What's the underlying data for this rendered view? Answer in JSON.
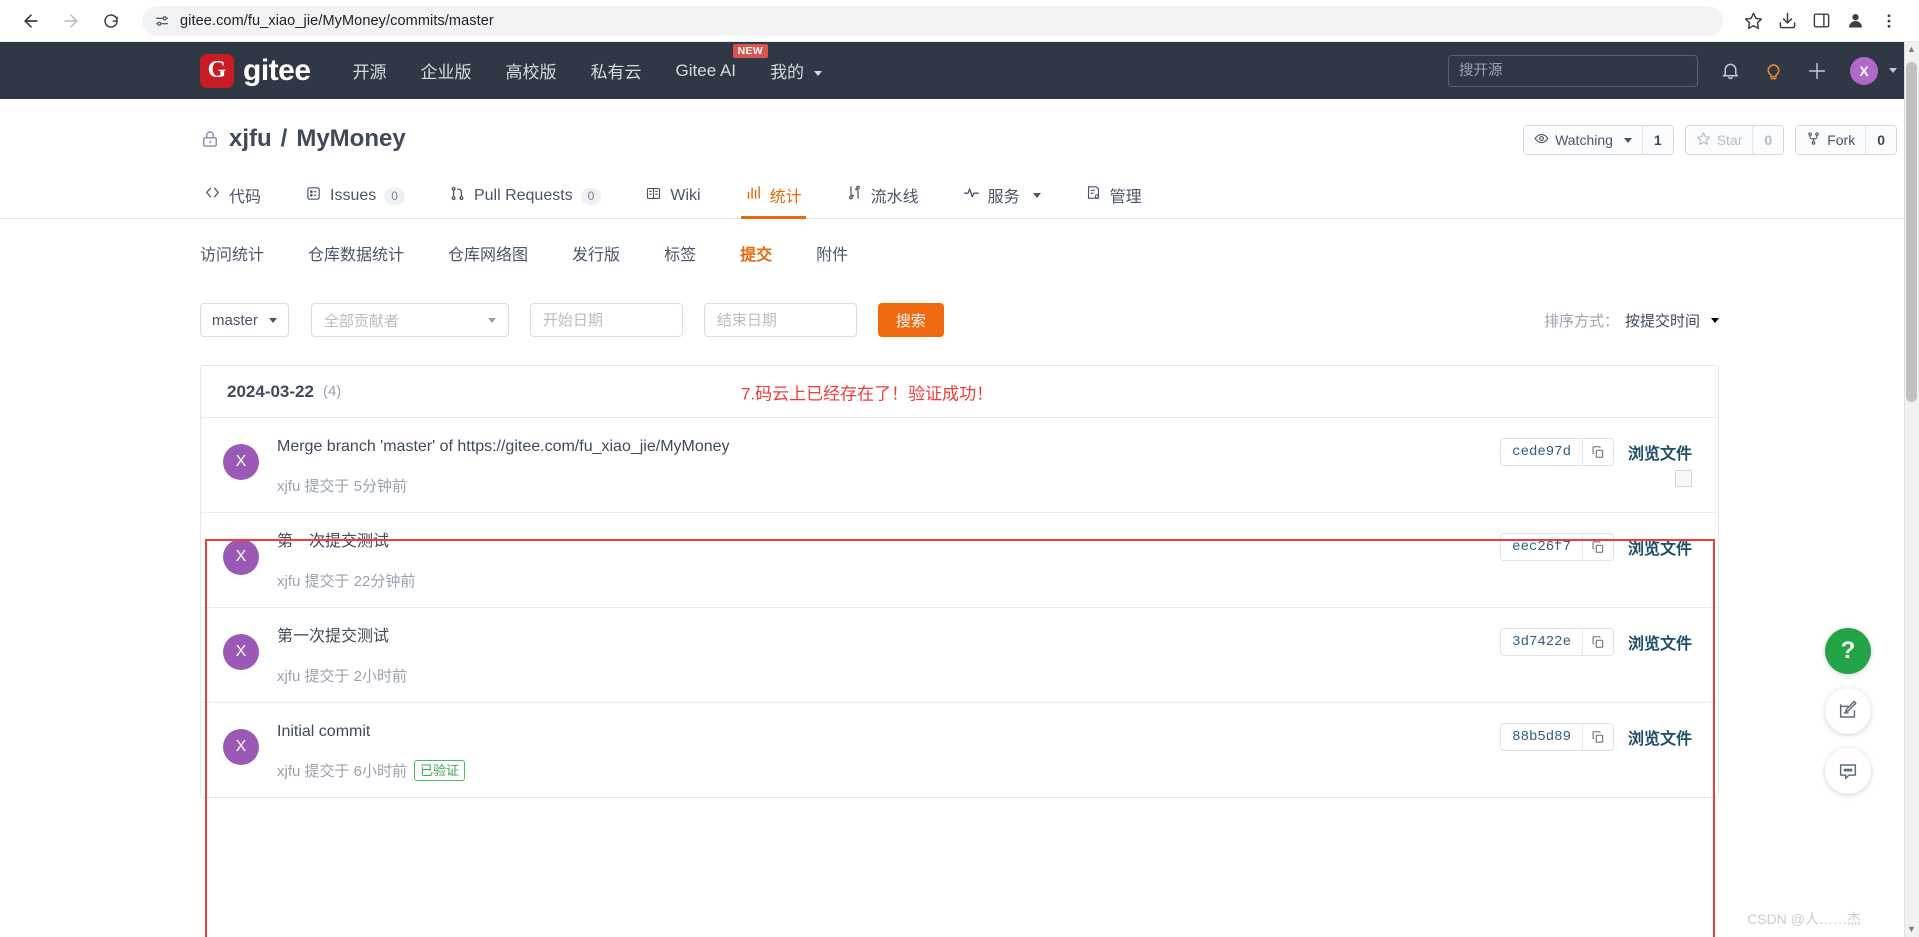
{
  "browser": {
    "url": "gitee.com/fu_xiao_jie/MyMoney/commits/master",
    "back_icon": "back-arrow-icon",
    "forward_icon": "forward-arrow-icon",
    "reload_icon": "reload-icon",
    "site_info_icon": "site-settings-icon",
    "bookmark_icon": "star-icon",
    "download_icon": "download-icon",
    "sidepanel_icon": "side-panel-icon",
    "profile_icon": "profile-icon",
    "menu_icon": "kebab-menu-icon"
  },
  "header": {
    "logo_mark": "G",
    "logo_text": "gitee",
    "nav": [
      {
        "label": "开源",
        "badge": null
      },
      {
        "label": "企业版",
        "badge": null
      },
      {
        "label": "高校版",
        "badge": null
      },
      {
        "label": "私有云",
        "badge": null
      },
      {
        "label": "Gitee AI",
        "badge": "NEW"
      },
      {
        "label": "我的",
        "badge": null
      }
    ],
    "search_placeholder": "搜开源",
    "icons": {
      "bell": "bell-icon",
      "bulb": "lightbulb-icon",
      "plus": "plus-icon"
    },
    "avatar_letter": "X",
    "accent_color": "#c71d23",
    "bg_color": "#2f3844"
  },
  "repo": {
    "owner": "xjfu",
    "separator": "/",
    "name": "MyMoney",
    "visibility_icon": "lock-icon",
    "actions": [
      {
        "id": "watching",
        "icon": "eye-icon",
        "label": "Watching",
        "count": "1",
        "muted": false,
        "has_caret": true
      },
      {
        "id": "star",
        "icon": "star-icon",
        "label": "Star",
        "count": "0",
        "muted": true,
        "has_caret": false
      },
      {
        "id": "fork",
        "icon": "fork-icon",
        "label": "Fork",
        "count": "0",
        "muted": false,
        "has_caret": false
      }
    ],
    "tabs": [
      {
        "id": "code",
        "icon": "code-icon",
        "label": "代码",
        "count": null,
        "active": false,
        "caret": false
      },
      {
        "id": "issues",
        "icon": "issue-icon",
        "label": "Issues",
        "count": "0",
        "active": false,
        "caret": false
      },
      {
        "id": "pulls",
        "icon": "pull-request-icon",
        "label": "Pull Requests",
        "count": "0",
        "active": false,
        "caret": false
      },
      {
        "id": "wiki",
        "icon": "wiki-icon",
        "label": "Wiki",
        "count": null,
        "active": false,
        "caret": false
      },
      {
        "id": "stats",
        "icon": "chart-icon",
        "label": "统计",
        "count": null,
        "active": true,
        "caret": false
      },
      {
        "id": "pipeline",
        "icon": "pipeline-icon",
        "label": "流水线",
        "count": null,
        "active": false,
        "caret": false
      },
      {
        "id": "service",
        "icon": "pulse-icon",
        "label": "服务",
        "count": null,
        "active": false,
        "caret": true
      },
      {
        "id": "manage",
        "icon": "settings-doc-icon",
        "label": "管理",
        "count": null,
        "active": false,
        "caret": false
      }
    ]
  },
  "subnav": [
    {
      "id": "visits",
      "label": "访问统计",
      "active": false
    },
    {
      "id": "repo-data",
      "label": "仓库数据统计",
      "active": false
    },
    {
      "id": "network",
      "label": "仓库网络图",
      "active": false
    },
    {
      "id": "releases",
      "label": "发行版",
      "active": false
    },
    {
      "id": "tags",
      "label": "标签",
      "active": false
    },
    {
      "id": "commits",
      "label": "提交",
      "active": true
    },
    {
      "id": "attachments",
      "label": "附件",
      "active": false
    }
  ],
  "filters": {
    "branch_value": "master",
    "contributor_value": "全部贡献者",
    "start_date_placeholder": "开始日期",
    "start_date_value": "",
    "end_date_placeholder": "结束日期",
    "end_date_value": "",
    "search_button": "搜索",
    "sort_label": "排序方式：",
    "sort_value": "按提交时间"
  },
  "commit_group": {
    "date": "2024-03-22",
    "count": "(4)",
    "annotation": "7.码云上已经存在了！验证成功！",
    "annotation_color": "#f03c3c",
    "browse_label": "浏览文件",
    "copy_icon": "copy-icon",
    "commits": [
      {
        "avatar": "X",
        "message": "Merge branch 'master' of https://gitee.com/fu_xiao_jie/MyMoney",
        "author": "xjfu",
        "meta": "xjfu 提交于 5分钟前",
        "sha": "cede97d",
        "verified": null,
        "has_checkbox": true
      },
      {
        "avatar": "X",
        "message": "第一次提交测试",
        "author": "xjfu",
        "meta": "xjfu 提交于 22分钟前",
        "sha": "eec26f7",
        "verified": null,
        "has_checkbox": false
      },
      {
        "avatar": "X",
        "message": "第一次提交测试",
        "author": "xjfu",
        "meta": "xjfu 提交于 2小时前",
        "sha": "3d7422e",
        "verified": null,
        "has_checkbox": false
      },
      {
        "avatar": "X",
        "message": "Initial commit",
        "author": "xjfu",
        "meta": "xjfu 提交于 6小时前",
        "sha": "88b5d89",
        "verified": "已验证",
        "has_checkbox": false
      }
    ]
  },
  "floating": {
    "help_label": "?",
    "feedback_icon": "edit-feedback-icon",
    "chat_icon": "chat-bubble-icon"
  },
  "watermark": "CSDN @人……杰"
}
